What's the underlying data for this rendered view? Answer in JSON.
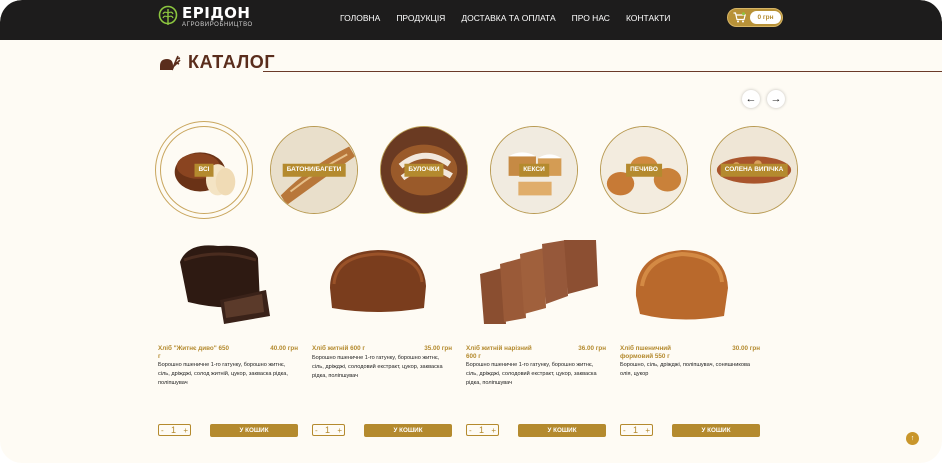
{
  "header": {
    "logo_title": "ЕРІДОН",
    "logo_subtitle": "АГРОВИРОБНИЦТВО",
    "nav": [
      "ГОЛОВНА",
      "ПРОДУКЦІЯ",
      "ДОСТАВКА ТА ОПЛАТА",
      "ПРО НАС",
      "КОНТАКТИ"
    ],
    "cart_total": "0 грн"
  },
  "catalog": {
    "title": "КАТАЛОГ",
    "prev_arrow": "←",
    "next_arrow": "→"
  },
  "categories": [
    {
      "label": "ВСІ"
    },
    {
      "label": "БАТОНИ/БАГЕТИ"
    },
    {
      "label": "БУЛОЧКИ"
    },
    {
      "label": "КЕКСИ"
    },
    {
      "label": "ПЕЧИВО"
    },
    {
      "label": "СОЛЕНА ВИПІЧКА"
    }
  ],
  "products": [
    {
      "name": "Хліб \"Житнє диво\" 650 г",
      "price": "40.00 грн",
      "description": "Борошно пшеничне 1-го гатунку, борошно житнє, сіль, дріжджі, солод житній, цукор, закваска рідка, поліпшувач",
      "quantity": "1",
      "add_label": "У КОШИК"
    },
    {
      "name": "Хліб житній 600 г",
      "price": "35.00 грн",
      "description": "Борошно пшеничне 1-го гатунку, борошно житнє, сіль, дріжджі, солодовий екстракт, цукор, закваска рідка, поліпшувач",
      "quantity": "1",
      "add_label": "У КОШИК"
    },
    {
      "name": "Хліб житній нарізний 600 г",
      "price": "36.00 грн",
      "description": "Борошно пшеничне 1-го гатунку, борошно житнє, сіль, дріжджі, солодовий екстракт, цукор, закваска рідка, поліпшувач",
      "quantity": "1",
      "add_label": "У КОШИК"
    },
    {
      "name": "Хліб пшеничний формовий 550 г",
      "price": "30.00 грн",
      "description": "Борошно, сіль, дріжджі, поліпшувач, соняшникова олія, цукор",
      "quantity": "1",
      "add_label": "У КОШИК"
    }
  ],
  "qty_minus": "-",
  "qty_plus": "+",
  "scroll_top": "↑",
  "colors": {
    "accent": "#b48a2e",
    "header_bg": "#1d1c1c",
    "page_bg": "#fefbf4",
    "title_brown": "#5a2d1c"
  }
}
